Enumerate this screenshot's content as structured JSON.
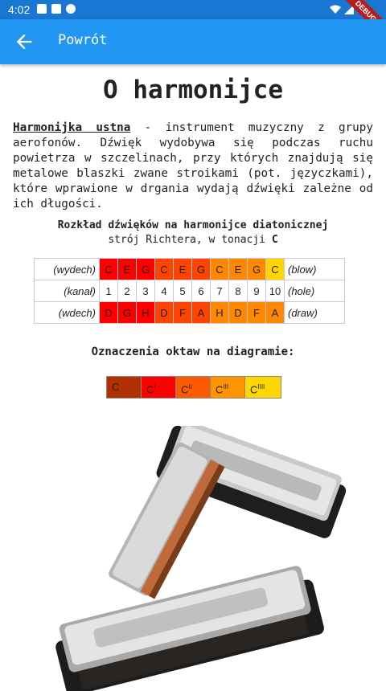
{
  "status": {
    "time": "4:02",
    "debug_label": "DEBUG"
  },
  "appbar": {
    "back_label": "Powrót"
  },
  "page": {
    "title": "O harmonijce",
    "term": "Harmonijka ustna",
    "description": " - instrument muzyczny z grupy aerofonów. Dźwięk wydobywa się podczas ruchu powietrza w szczelinach, przy których znajdują się metalowe blaszki zwane stroikami (pot. języczkami), które wprawione w drgania wydają dźwięki zależne od ich długości.",
    "table_caption": "Rozkład dźwięków na harmonijce diatonicznej",
    "tuning_prefix": "strój Richtera, w tonacji ",
    "tuning_key": "C"
  },
  "table": {
    "blow_label_left": "(wydech)",
    "blow_label_right": "(blow)",
    "hole_label_left": "(kanał)",
    "hole_label_right": "(hole)",
    "draw_label_left": "(wdech)",
    "draw_label_right": "(draw)",
    "blow": [
      "C",
      "E",
      "G",
      "C",
      "E",
      "G",
      "C",
      "E",
      "G",
      "C"
    ],
    "holes": [
      "1",
      "2",
      "3",
      "4",
      "5",
      "6",
      "7",
      "8",
      "9",
      "10"
    ],
    "draw": [
      "D",
      "G",
      "H",
      "D",
      "F",
      "A",
      "H",
      "D",
      "F",
      "A"
    ],
    "blow_colors": [
      "#ff0000",
      "#ff0000",
      "#ff0000",
      "#ff4400",
      "#ff4400",
      "#ff4400",
      "#ff8800",
      "#ff8800",
      "#ff8800",
      "#ffd700"
    ],
    "draw_colors": [
      "#ff0000",
      "#ff0000",
      "#ff0000",
      "#ff4400",
      "#ff4400",
      "#ff4400",
      "#ff8800",
      "#ff8800",
      "#ff8800",
      "#ff8800"
    ]
  },
  "octaves": {
    "title": "Oznaczenia oktaw na diagramie:",
    "items": [
      {
        "note": "C",
        "mark": "",
        "color": "#b03000"
      },
      {
        "note": "C",
        "mark": "I",
        "color": "#ff0000"
      },
      {
        "note": "C",
        "mark": "II",
        "color": "#ff5a00"
      },
      {
        "note": "C",
        "mark": "III",
        "color": "#ff9400"
      },
      {
        "note": "C",
        "mark": "IIII",
        "color": "#ffd700"
      }
    ]
  }
}
